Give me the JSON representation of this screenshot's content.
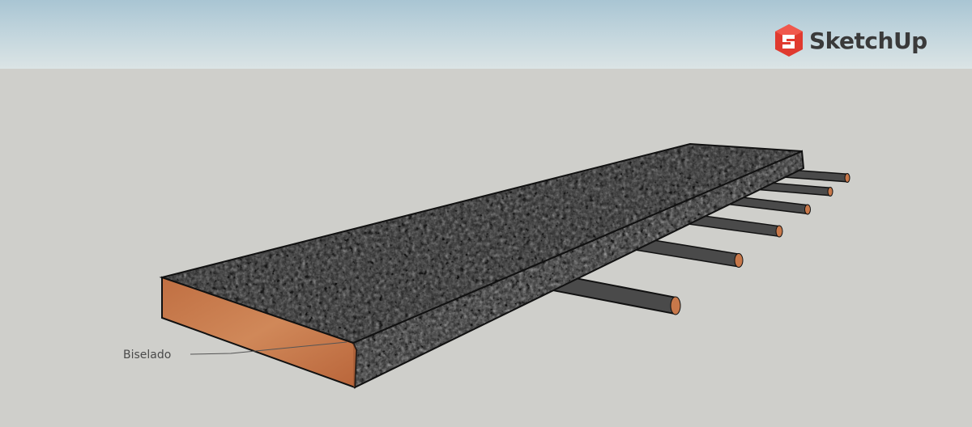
{
  "app": {
    "logo_text": "SketchUp",
    "logo_icon": "sketchup-logo-icon"
  },
  "model": {
    "annotation": "Biselado",
    "colors": {
      "granite": "#2d2d2d",
      "wood_end": "#c8784a",
      "outline": "#111111",
      "sky_top": "#a9c5d3",
      "ground": "#cfcfcb",
      "logo_red": "#e03a2f"
    }
  }
}
